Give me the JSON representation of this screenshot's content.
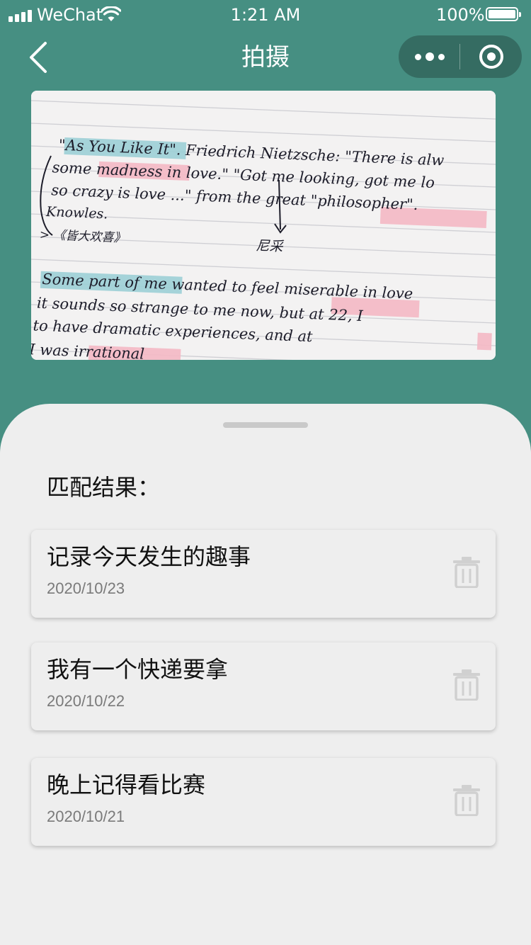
{
  "status_bar": {
    "carrier": "WeChat",
    "time": "1:21 AM",
    "battery": "100%"
  },
  "nav": {
    "title": "拍摄"
  },
  "photo": {
    "lines": [
      "\"As You Like It\". Friedrich Nietzsche: \"There is alw",
      "some madness in love.\" \"Got me looking, got me lo",
      "so crazy is love ...\" from the great \"philosopher\".",
      "Knowles.",
      "> 《皆大欢喜》",
      "尼采",
      "Some part of me wanted to feel miserable in love",
      "it sounds so strange to me now, but at 22, I",
      "to have dramatic experiences, and at",
      "I was irrational"
    ]
  },
  "results": {
    "heading": "匹配结果：",
    "items": [
      {
        "title": "记录今天发生的趣事",
        "date": "2020/10/23"
      },
      {
        "title": "我有一个快递要拿",
        "date": "2020/10/22"
      },
      {
        "title": "晚上记得看比赛",
        "date": "2020/10/21"
      }
    ]
  },
  "colors": {
    "header_bg": "#468f82",
    "sheet_bg": "#eeeeee",
    "highlight_blue": "#9ccfd6",
    "highlight_pink": "#f4b8c4"
  },
  "icons": {
    "back": "back-arrow-icon",
    "more": "more-dots-icon",
    "close": "target-circle-icon",
    "delete": "trash-icon"
  }
}
